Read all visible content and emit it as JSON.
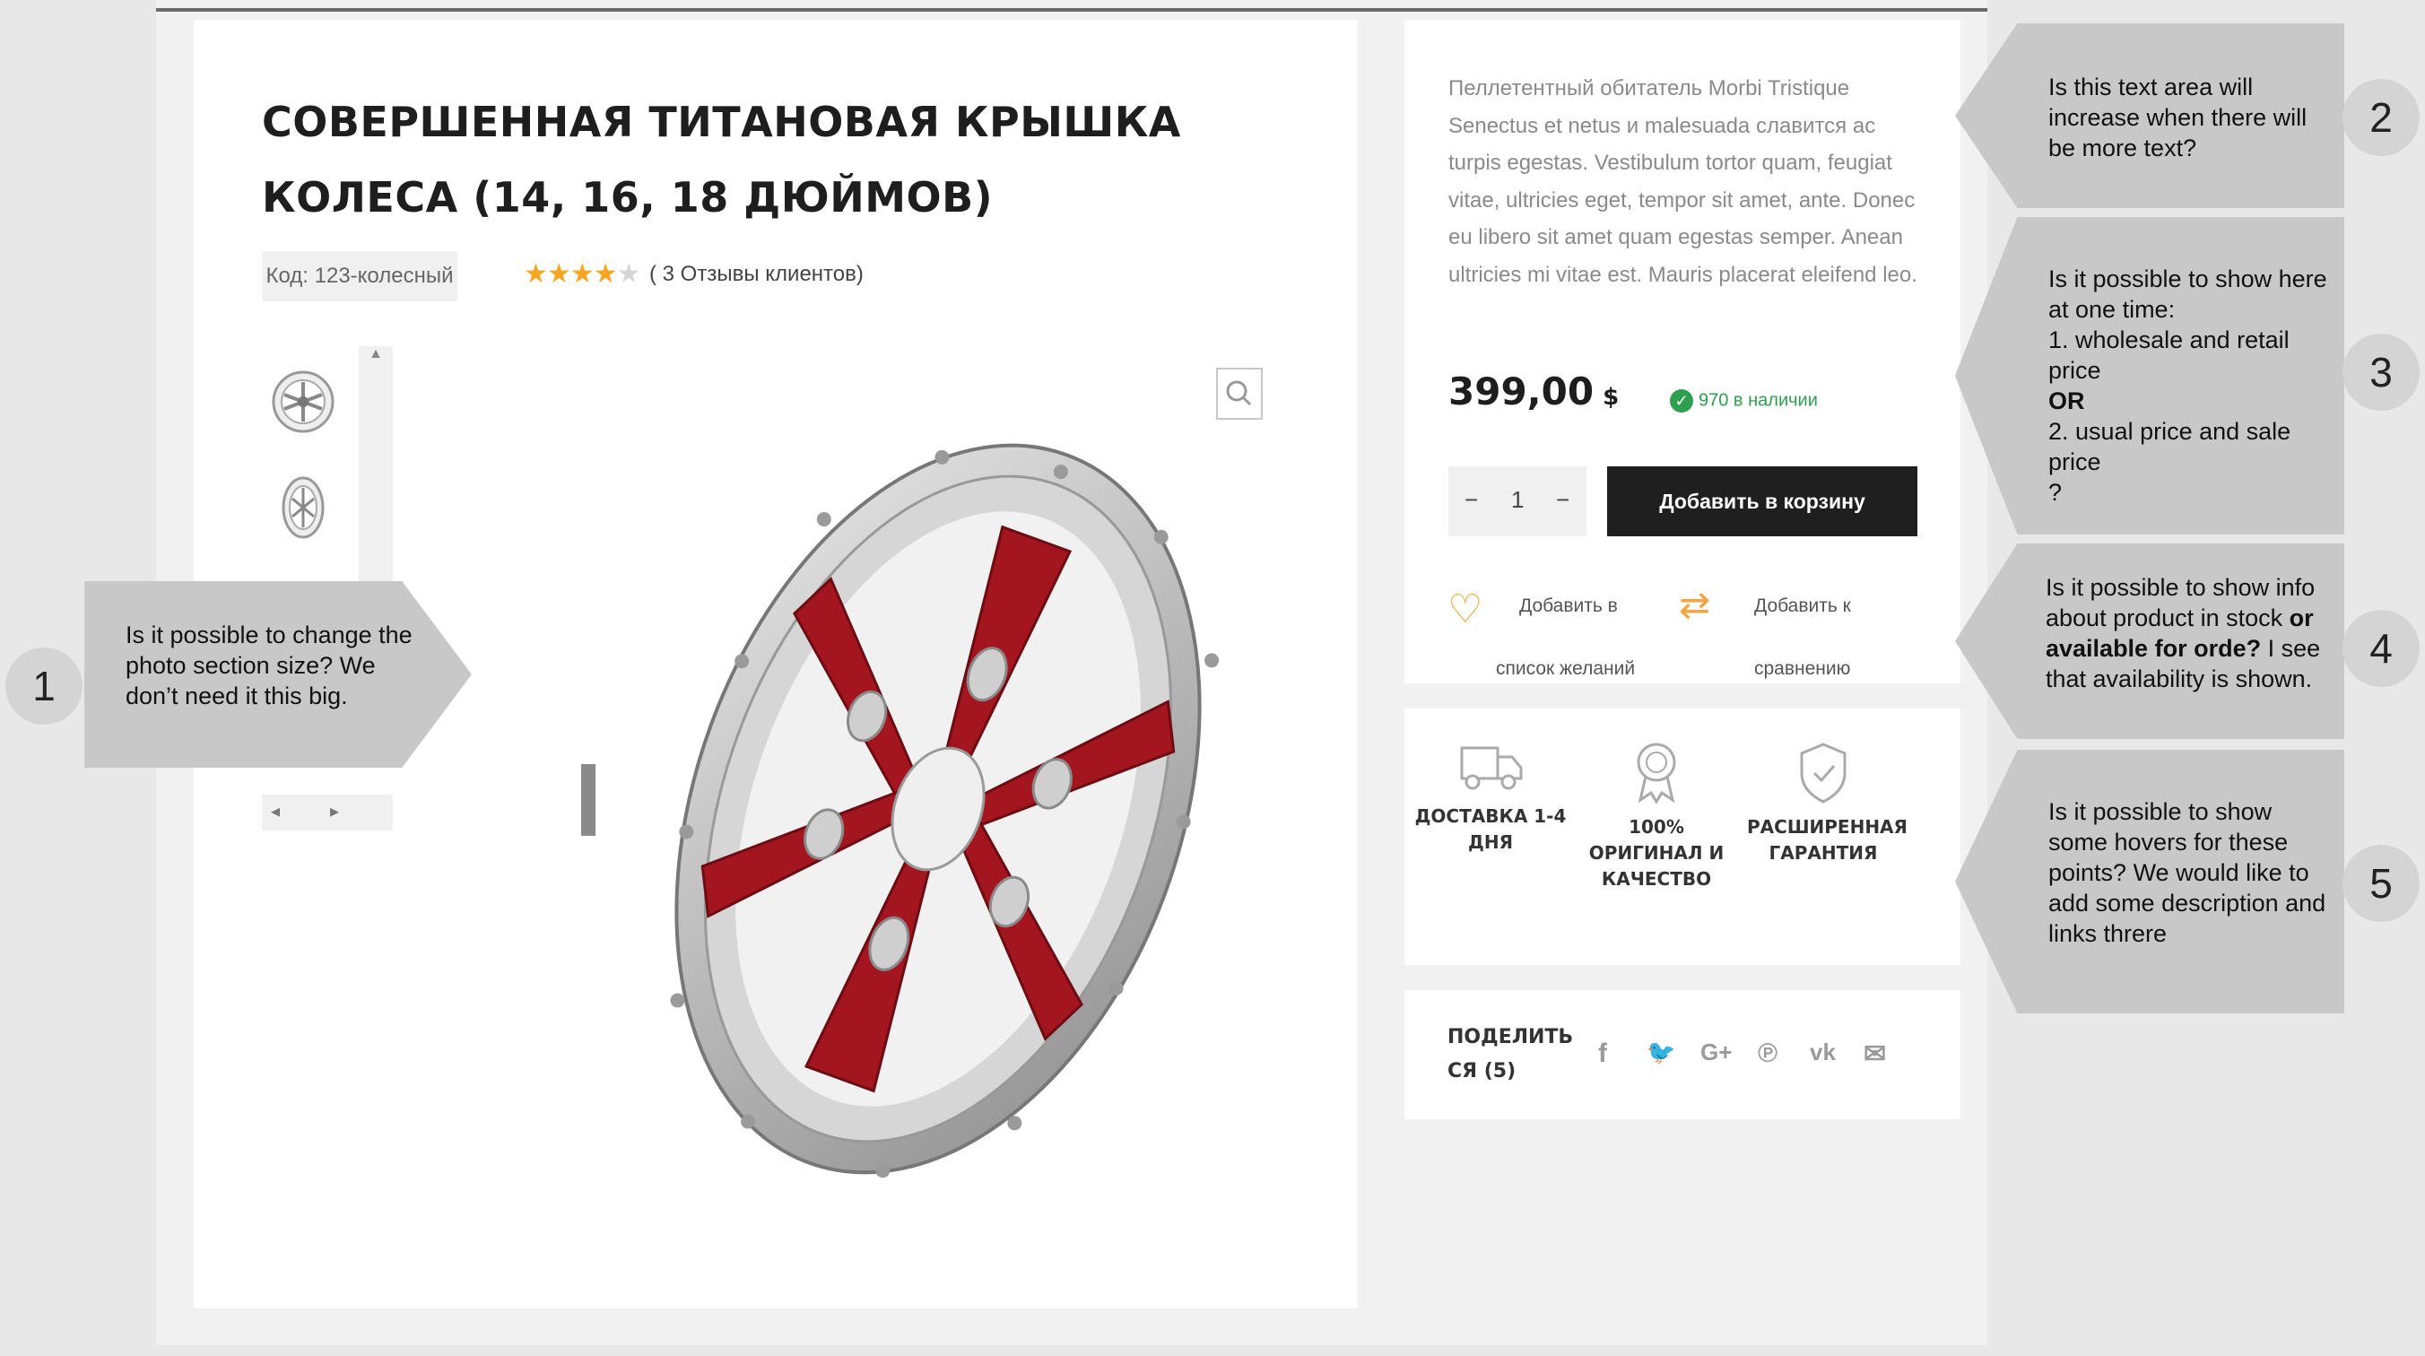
{
  "product": {
    "title_line1": "СОВЕРШЕННАЯ ТИТАНОВАЯ КРЫШКА",
    "title_line2": "КОЛЕСА (14, 16, 18 ДЮЙМОВ)",
    "sku": "Код: 123-колесный",
    "rating": 4,
    "rating_max": 5,
    "reviews": "( 3 Отзывы клиентов)",
    "description": "Пеллетентный обитатель Morbi Tristique Senectus et netus и malesuada славится ac turpis egestas. Vestibulum tortor quam, feugiat vitae, ultricies eget, tempor sit amet, ante. Donec eu libero sit amet quam egestas semper. Anean ultricies mi vitae est. Mauris placerat eleifend leo.",
    "price": "399,00",
    "currency": "$",
    "stock": "970 в наличии",
    "qty": "1",
    "qty_minus": "−",
    "qty_plus": "−",
    "add_to_cart": "Добавить в корзину",
    "wishlist_line1": "Добавить в",
    "wishlist_line2": "список желаний",
    "compare_line1": "Добавить к",
    "compare_line2": "сравнению"
  },
  "features": [
    {
      "icon": "truck-icon",
      "label": "ДОСТАВКА 1-4 ДНЯ"
    },
    {
      "icon": "award-icon",
      "label": "100% ОРИГИНАЛ И КАЧЕСТВО"
    },
    {
      "icon": "shield-icon",
      "label": "РАСШИРЕННАЯ ГАРАНТИЯ"
    }
  ],
  "share": {
    "label": "ПОДЕЛИТЬ СЯ (5)",
    "icons": [
      "facebook-icon",
      "twitter-icon",
      "google-plus-icon",
      "pinterest-icon",
      "vk-icon",
      "email-icon"
    ],
    "glyphs": {
      "facebook": "f",
      "twitter": "🐦",
      "gplus": "G+",
      "pinterest": "℗",
      "vk": "vk",
      "email": "✉"
    }
  },
  "gallery": {
    "nav_prev": "◂",
    "nav_next": "▸",
    "scroll_up": "▲"
  },
  "callouts": {
    "c1": {
      "number": "1",
      "text": "Is it possible to change the photo section size? We don’t need it this big."
    },
    "c2": {
      "number": "2",
      "text": "Is this text area will increase  when there will be more text?"
    },
    "c3": {
      "number": "3",
      "line1": "Is it possible to show here at one time:",
      "line2": "1. wholesale and retail price",
      "line3": "OR",
      "line4": "2. usual price and sale price",
      "line5": "?"
    },
    "c4": {
      "number": "4",
      "text_a": "Is it possible to show info about product in stock ",
      "text_bold": "or available for orde?",
      "text_b": " I see that availability is shown."
    },
    "c5": {
      "number": "5",
      "text": "Is it possible to show some hovers for these points? We would like to add some description and links threre"
    }
  },
  "colors": {
    "accent": "#f2a541",
    "stock_green": "#2e9e4f",
    "button_dark": "#1f1f1f",
    "wheel_red": "#a3161f",
    "callout_gray": "#c8c8c8"
  }
}
